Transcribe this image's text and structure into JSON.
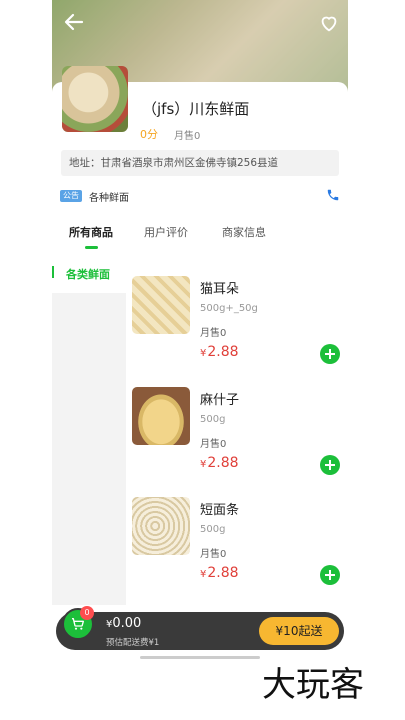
{
  "shop": {
    "name": "（jfs）川东鲜面",
    "score": "0分",
    "monthly_sales": "月售0",
    "address": "地址：甘肃省酒泉市肃州区金佛寺镇256县道",
    "notice_badge": "公告",
    "notice_text": "各种鲜面"
  },
  "tabs": [
    {
      "label": "所有商品",
      "active": true
    },
    {
      "label": "用户评价",
      "active": false
    },
    {
      "label": "商家信息",
      "active": false
    }
  ],
  "category": {
    "label": "各类鲜面"
  },
  "products": [
    {
      "name": "猫耳朵",
      "spec": "500g+_50g",
      "sales": "月售0",
      "currency": "¥",
      "price": "2.88"
    },
    {
      "name": "麻什子",
      "spec": "500g",
      "sales": "月售0",
      "currency": "¥",
      "price": "2.88"
    },
    {
      "name": "短面条",
      "spec": "500g",
      "sales": "月售0",
      "currency": "¥",
      "price": "2.88"
    }
  ],
  "cart": {
    "badge_count": "0",
    "currency": "¥",
    "total": "0.00",
    "delivery": "预估配送费¥1",
    "checkout_label": "¥10起送"
  },
  "watermark": "大玩客",
  "colors": {
    "accent": "#1cbf3a",
    "price": "#e0403a",
    "checkout": "#f7b731",
    "score": "#f5a623"
  }
}
